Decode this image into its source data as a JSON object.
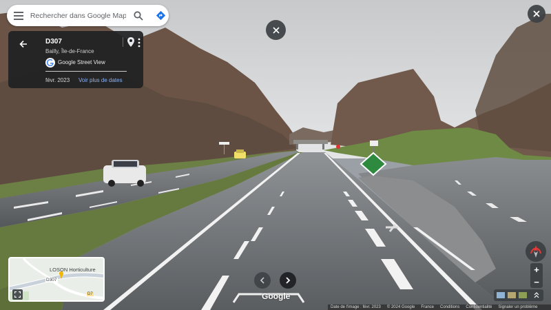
{
  "search": {
    "placeholder": "Rechercher dans Google Maps"
  },
  "card": {
    "title": "D307",
    "subtitle": "Bailly, Île-de-France",
    "brand": "Google Street View",
    "date": "févr. 2023",
    "more_dates_link": "Voir plus de dates"
  },
  "minimap": {
    "place_label": "LOSON Horticulture",
    "road_label_1": "D307",
    "road_label_2": "D7"
  },
  "scene": {
    "road_signs": [
      "Google"
    ]
  },
  "google_word": "Google",
  "footer": {
    "image_date": "Date de l'image : févr. 2023",
    "copyright": "© 2024 Google",
    "country": "France",
    "terms": "Conditions",
    "privacy": "Confidentialité",
    "report": "Signaler un problème"
  },
  "controls": {
    "zoom_in": "+",
    "zoom_out": "−"
  },
  "colors": {
    "card_bg": "#202124",
    "link": "#8ab4f8",
    "directions": "#1a73e8"
  }
}
